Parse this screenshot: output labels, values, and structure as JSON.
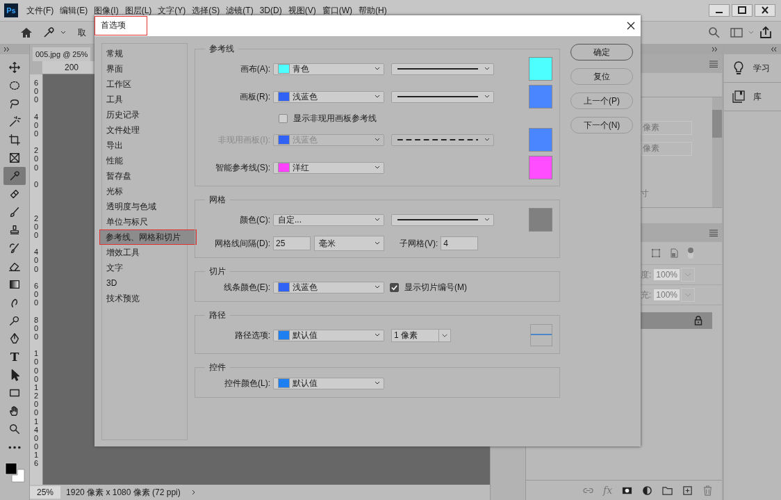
{
  "app": {
    "logo": "Ps",
    "menu": [
      "文件(F)",
      "编辑(E)",
      "图像(I)",
      "图层(L)",
      "文字(Y)",
      "选择(S)",
      "滤镜(T)",
      "3D(D)",
      "视图(V)",
      "窗口(W)",
      "帮助(H)"
    ]
  },
  "options_bar": {
    "label": "取"
  },
  "tools": [
    {
      "kind": "move",
      "selected": false
    },
    {
      "kind": "marquee",
      "selected": false
    },
    {
      "kind": "lasso",
      "selected": false
    },
    {
      "kind": "wand",
      "selected": false
    },
    {
      "kind": "crop",
      "selected": false
    },
    {
      "kind": "frame",
      "selected": false
    },
    {
      "kind": "eyedropper",
      "selected": true
    },
    {
      "kind": "bandage",
      "selected": false
    },
    {
      "kind": "brush",
      "selected": false
    },
    {
      "kind": "stamp",
      "selected": false
    },
    {
      "kind": "history",
      "selected": false
    },
    {
      "kind": "eraser",
      "selected": false
    },
    {
      "kind": "gradient",
      "selected": false
    },
    {
      "kind": "smudge",
      "selected": false
    },
    {
      "kind": "dodge",
      "selected": false
    },
    {
      "kind": "pen",
      "selected": false
    },
    {
      "kind": "type",
      "selected": false,
      "glyph": "T"
    },
    {
      "kind": "arrow",
      "selected": false
    },
    {
      "kind": "rectangle",
      "selected": false
    },
    {
      "kind": "hand",
      "selected": false
    },
    {
      "kind": "zoom",
      "selected": false
    },
    {
      "kind": "more",
      "selected": false
    }
  ],
  "colors": {
    "foreground": {
      "color": "#000000"
    },
    "background": {
      "color": "#ffffff"
    }
  },
  "document": {
    "tab": "005.jpg @ 25%",
    "ruler_h": "200",
    "ruler_v": [
      "600",
      "400",
      "200",
      "0",
      "200",
      "400",
      "600",
      "800",
      "1000",
      "1200",
      "1400",
      "16"
    ],
    "zoom": "25%",
    "info": "1920 像素 x 1080 像素 (72 ppi)"
  },
  "panels": {
    "learn": "学习",
    "library": "库",
    "fields": [
      "像素",
      "像素"
    ],
    "fragment": "寸",
    "opacity_label": "度:",
    "opacity": "100%",
    "fill_label": "充:",
    "fill": "100%",
    "fx": "fx"
  },
  "dialog": {
    "title": "首选项",
    "title_highlighted": true,
    "categories": [
      {
        "label": "常规",
        "selected": false,
        "highlighted": false
      },
      {
        "label": "界面",
        "selected": false,
        "highlighted": false
      },
      {
        "label": "工作区",
        "selected": false,
        "highlighted": false
      },
      {
        "label": "工具",
        "selected": false,
        "highlighted": false
      },
      {
        "label": "历史记录",
        "selected": false,
        "highlighted": false
      },
      {
        "label": "文件处理",
        "selected": false,
        "highlighted": false
      },
      {
        "label": "导出",
        "selected": false,
        "highlighted": false
      },
      {
        "label": "性能",
        "selected": false,
        "highlighted": false
      },
      {
        "label": "暂存盘",
        "selected": false,
        "highlighted": false
      },
      {
        "label": "光标",
        "selected": false,
        "highlighted": false
      },
      {
        "label": "透明度与色域",
        "selected": false,
        "highlighted": false
      },
      {
        "label": "单位与标尺",
        "selected": false,
        "highlighted": false
      },
      {
        "label": "参考线、网格和切片",
        "selected": true,
        "highlighted": true
      },
      {
        "label": "增效工具",
        "selected": false,
        "highlighted": false
      },
      {
        "label": "文字",
        "selected": false,
        "highlighted": false
      },
      {
        "label": "3D",
        "selected": false,
        "highlighted": false
      },
      {
        "label": "技术预览",
        "selected": false,
        "highlighted": false
      }
    ],
    "sections": [
      {
        "title": "参考线",
        "rows": [
          {
            "kind": "color",
            "label": "画布(A):",
            "color": "#4dffff",
            "value": "青色",
            "line": {
              "kind": "solid"
            },
            "preview": {
              "color": "#4dffff"
            },
            "disabled": false
          },
          {
            "kind": "color",
            "label": "画板(R):",
            "color": "#2f62f5",
            "value": "浅蓝色",
            "line": {
              "kind": "solid"
            },
            "preview": {
              "color": "#4a86ff"
            },
            "disabled": false
          },
          {
            "kind": "checkbox",
            "label": "显示非现用画板参考线",
            "checked": false
          },
          {
            "kind": "color",
            "label": "非现用画板(I):",
            "color": "#2f62f5",
            "value": "浅蓝色",
            "line": {
              "kind": "dashed"
            },
            "preview": {
              "color": "#4a86ff"
            },
            "disabled": true
          },
          {
            "kind": "color",
            "label": "智能参考线(S):",
            "color": "#ff40ff",
            "value": "洋红",
            "preview": {
              "color": "#ff4dff"
            },
            "disabled": false
          }
        ]
      },
      {
        "title": "网格",
        "rows": [
          {
            "kind": "color",
            "label": "颜色(C):",
            "value": "自定...",
            "line": {
              "kind": "solid"
            },
            "preview": {
              "color": "#808080"
            },
            "disabled": false
          },
          {
            "kind": "spacing",
            "label": "网格线间隔(D):",
            "value": "25",
            "unit": "毫米",
            "sub_label": "子网格(V):",
            "sub_value": "4"
          }
        ]
      },
      {
        "title": "切片",
        "rows": [
          {
            "kind": "color",
            "label": "线条颜色(E):",
            "color": "#2f62f5",
            "value": "浅蓝色",
            "disabled": false,
            "check": {
              "label": "显示切片编号(M)",
              "checked": true
            }
          }
        ]
      },
      {
        "title": "路径",
        "rows": [
          {
            "kind": "color",
            "label": "路径选项:",
            "color": "#1e7ff0",
            "value": "默认值",
            "size": "1 像素",
            "path_preview": {
              "color": "#4a86c8"
            },
            "disabled": false
          }
        ]
      },
      {
        "title": "控件",
        "rows": [
          {
            "kind": "color",
            "label": "控件颜色(L):",
            "color": "#1e7ff0",
            "value": "默认值",
            "disabled": false
          }
        ]
      }
    ],
    "buttons": [
      {
        "label": "确定",
        "default": true
      },
      {
        "label": "复位",
        "default": false
      },
      {
        "label": "上一个(P)",
        "default": false
      },
      {
        "label": "下一个(N)",
        "default": false
      }
    ]
  }
}
